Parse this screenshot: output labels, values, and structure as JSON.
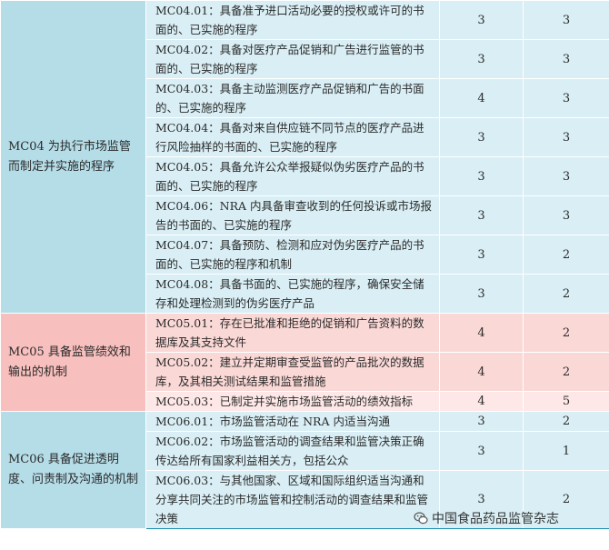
{
  "groups": [
    {
      "category": "MC04 为执行市场监管而制定并实施的程序",
      "rows": [
        {
          "desc": "MC04.01：具备准予进口活动必要的授权或许可的书面的、已实施的程序",
          "a": "3",
          "b": "3"
        },
        {
          "desc": "MC04.02：具备对医疗产品促销和广告进行监管的书面的、已实施的程序",
          "a": "3",
          "b": "3"
        },
        {
          "desc": "MC04.03：具备主动监测医疗产品促销和广告的书面的、已实施的程序",
          "a": "4",
          "b": "3"
        },
        {
          "desc": "MC04.04：具备对来自供应链不同节点的医疗产品进行风险抽样的书面的、已实施的程序",
          "a": "3",
          "b": "3"
        },
        {
          "desc": "MC04.05：具备允许公众举报疑似伪劣医疗产品的书面的、已实施的程序",
          "a": "3",
          "b": "3"
        },
        {
          "desc": "MC04.06：NRA 内具备审查收到的任何投诉或市场报告的书面的、已实施的程序",
          "a": "3",
          "b": "3"
        },
        {
          "desc": "MC04.07：具备预防、检测和应对伪劣医疗产品的书面的、已实施的程序和机制",
          "a": "3",
          "b": "2"
        },
        {
          "desc": "MC04.08：具备书面的、已实施的程序，确保安全储存和处理检测到的伪劣医疗产品",
          "a": "3",
          "b": "2"
        }
      ]
    },
    {
      "category": "MC05 具备监管绩效和输出的机制",
      "rows": [
        {
          "desc": "MC05.01：存在已批准和拒绝的促销和广告资料的数据库及其支持文件",
          "a": "4",
          "b": "2"
        },
        {
          "desc": "MC05.02：建立并定期审查受监管的产品批次的数据库，及其相关测试结果和监管措施",
          "a": "4",
          "b": "2"
        },
        {
          "desc": "MC05.03：已制定并实施市场监管活动的绩效指标",
          "a": "4",
          "b": "5"
        }
      ]
    },
    {
      "category": "MC06 具备促进透明度、问责制及沟通的机制",
      "rows": [
        {
          "desc": "MC06.01：市场监管活动在 NRA 内适当沟通",
          "a": "3",
          "b": "2"
        },
        {
          "desc": "MC06.02：市场监管活动的调查结果和监管决策正确传达给所有国家利益相关方，包括公众",
          "a": "3",
          "b": "1"
        },
        {
          "desc": "MC06.03：与其他国家、区域和国际组织适当沟通和分享共同关注的市场监管和控制活动的调查结果和监管决策",
          "a": "3",
          "b": "2"
        }
      ]
    }
  ],
  "watermark": {
    "text": "中国食品药品监管杂志",
    "icon": "wechat-icon"
  }
}
